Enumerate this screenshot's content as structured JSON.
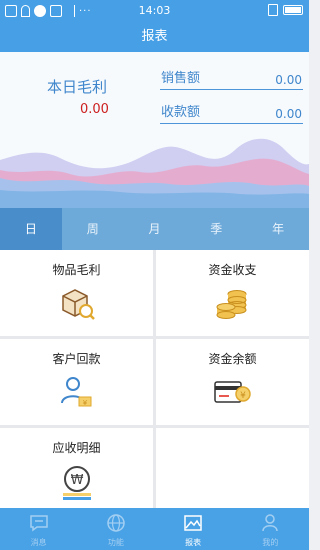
{
  "status_bar": {
    "time": "14:03",
    "notification_dots": "···"
  },
  "header": {
    "title": "报表"
  },
  "summary": {
    "profit_label": "本日毛利",
    "profit_value": "0.00",
    "sales_label": "销售额",
    "sales_value": "0.00",
    "collection_label": "收款额",
    "collection_value": "0.00"
  },
  "period_tabs": [
    {
      "label": "日",
      "active": true
    },
    {
      "label": "周",
      "active": false
    },
    {
      "label": "月",
      "active": false
    },
    {
      "label": "季",
      "active": false
    },
    {
      "label": "年",
      "active": false
    }
  ],
  "cards": [
    {
      "title": "物品毛利",
      "icon": "box-magnifier-icon"
    },
    {
      "title": "资金收支",
      "icon": "coin-stack-icon"
    },
    {
      "title": "客户回款",
      "icon": "customer-payment-icon"
    },
    {
      "title": "资金余额",
      "icon": "card-balance-icon"
    },
    {
      "title": "应收明细",
      "icon": "won-coin-icon"
    }
  ],
  "bottom_nav": [
    {
      "label": "消息",
      "icon": "message-icon",
      "active": false
    },
    {
      "label": "功能",
      "icon": "globe-icon",
      "active": false
    },
    {
      "label": "报表",
      "icon": "image-chart-icon",
      "active": true
    },
    {
      "label": "我的",
      "icon": "person-icon",
      "active": false
    }
  ],
  "colors": {
    "primary": "#47a0e6",
    "profit_red": "#cc1f1f",
    "tab_active": "#4a8dcb",
    "accent_gold": "#e0a82e"
  }
}
